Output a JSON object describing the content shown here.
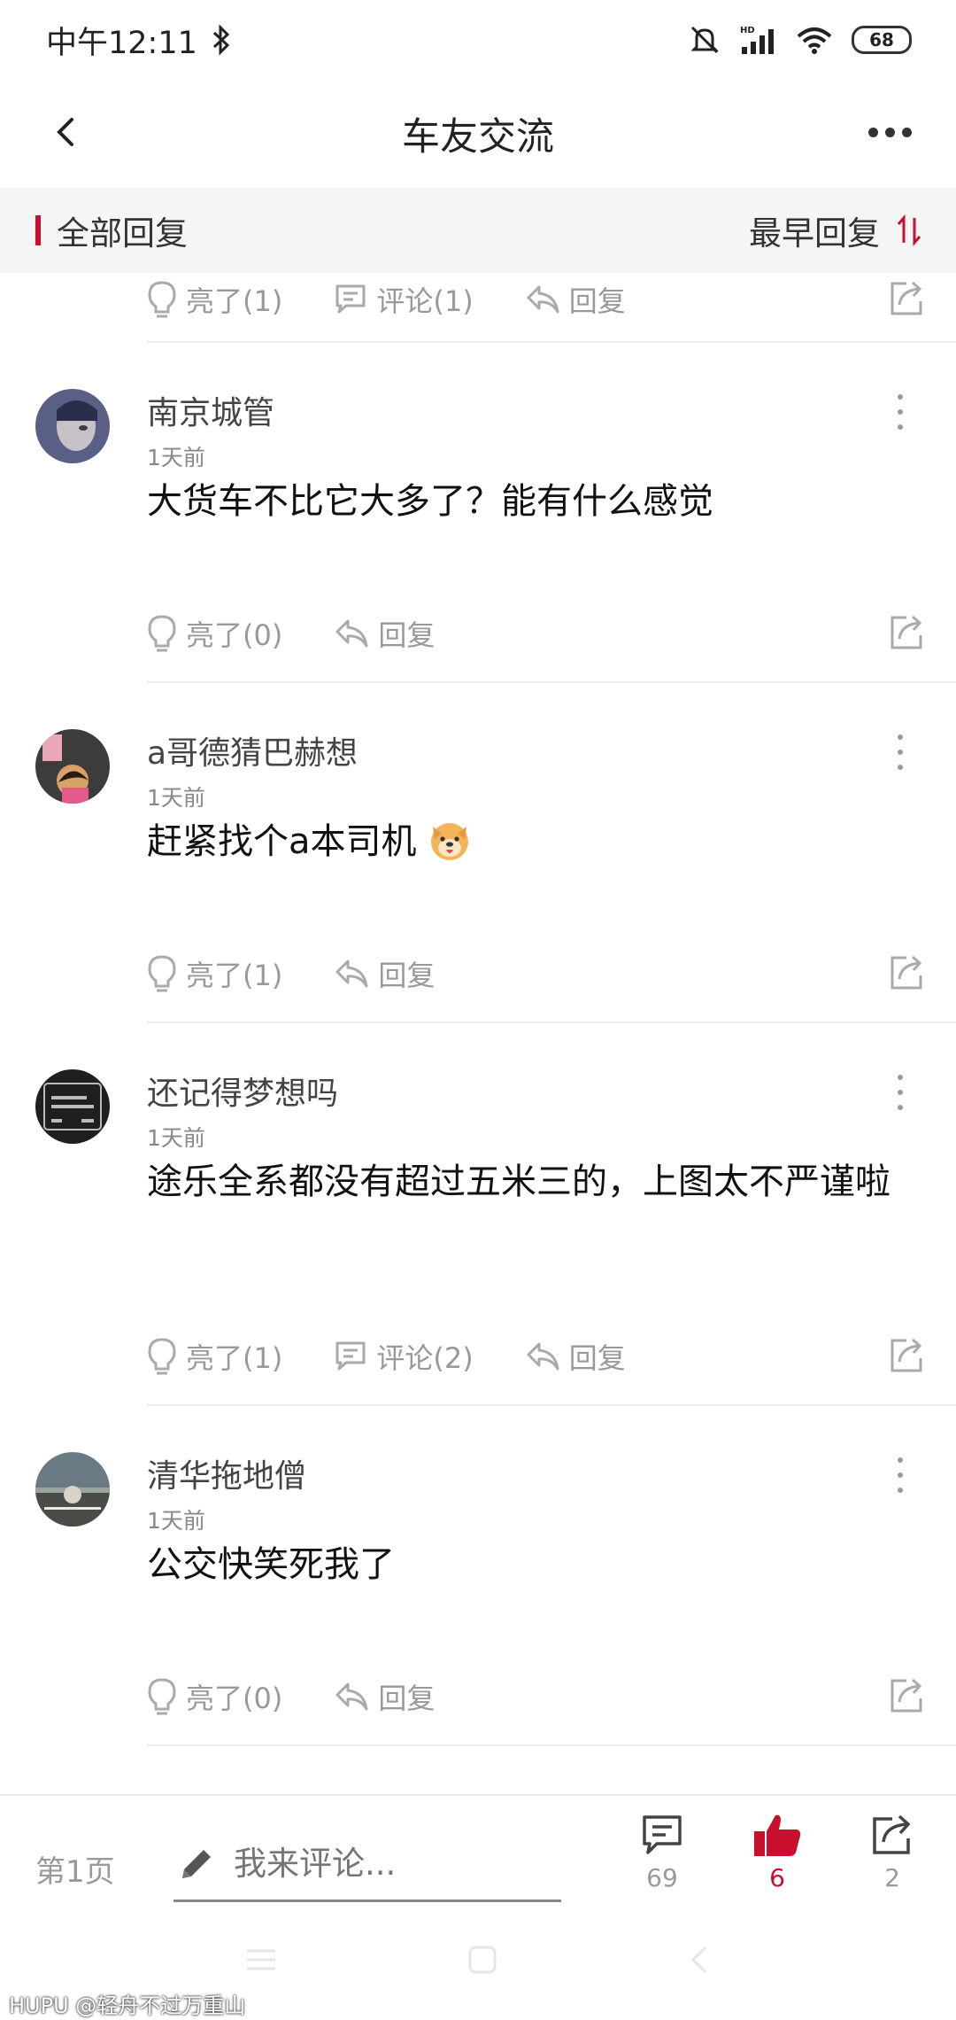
{
  "status_bar": {
    "time": "中午12:11",
    "battery": "68"
  },
  "nav": {
    "title": "车友交流"
  },
  "section": {
    "title": "全部回复",
    "sort_label": "最早回复"
  },
  "top_partial_actions": {
    "like": "亮了(1)",
    "comment": "评论(1)",
    "reply": "回复"
  },
  "comments": [
    {
      "username": "南京城管",
      "time": "1天前",
      "content": "大货车不比它大多了？能有什么感觉",
      "like": "亮了(0)",
      "reply": "回复"
    },
    {
      "username": "a哥德猜巴赫想",
      "time": "1天前",
      "content": "赶紧找个a本司机",
      "like": "亮了(1)",
      "reply": "回复"
    },
    {
      "username": "还记得梦想吗",
      "time": "1天前",
      "content": "途乐全系都没有超过五米三的，上图太不严谨啦",
      "like": "亮了(1)",
      "comment": "评论(2)",
      "reply": "回复"
    },
    {
      "username": "清华拖地僧",
      "time": "1天前",
      "content": "公交快笑死我了",
      "like": "亮了(0)",
      "reply": "回复"
    }
  ],
  "bottom_bar": {
    "page_label": "第1页",
    "input_placeholder": "我来评论...",
    "comment_count": "69",
    "like_count": "6",
    "share_count": "2"
  },
  "watermark": "HUPU @轻舟不过万重山",
  "colors": {
    "accent": "#c8102e",
    "muted": "#999999"
  },
  "icons": [
    "bluetooth-icon",
    "mute-icon",
    "signal-icon",
    "wifi-icon",
    "back-icon",
    "more-icon",
    "sort-icon",
    "bulb-icon",
    "comment-bubble-icon",
    "reply-icon",
    "share-icon",
    "pencil-icon",
    "thumb-up-icon"
  ]
}
